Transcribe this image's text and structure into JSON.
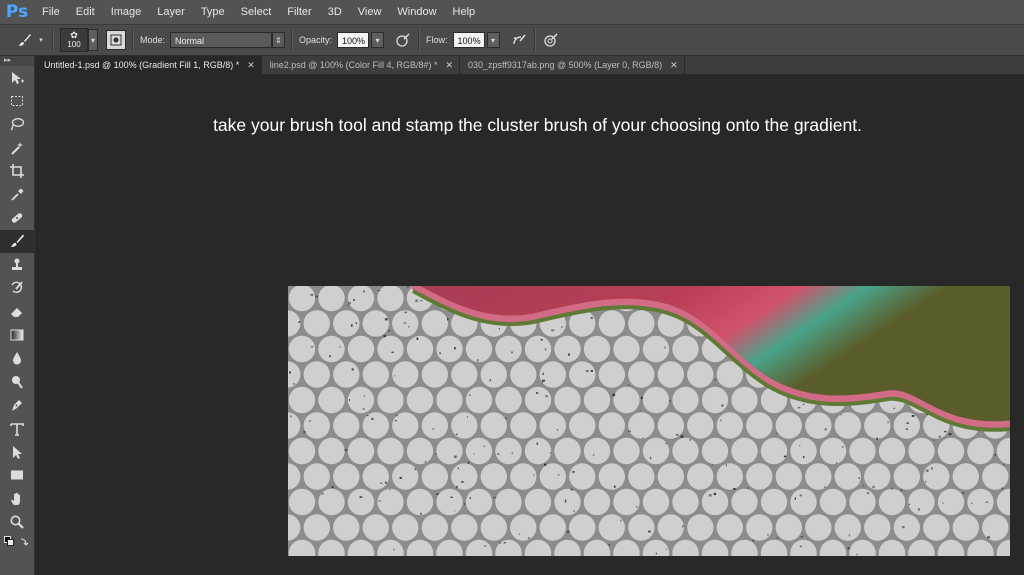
{
  "app": {
    "logo": "Ps"
  },
  "menu": [
    "File",
    "Edit",
    "Image",
    "Layer",
    "Type",
    "Select",
    "Filter",
    "3D",
    "View",
    "Window",
    "Help"
  ],
  "options": {
    "tool_icon": "brush-icon",
    "brush_size": "100",
    "mode_label": "Mode:",
    "mode_value": "Normal",
    "opacity_label": "Opacity:",
    "opacity_value": "100%",
    "flow_label": "Flow:",
    "flow_value": "100%"
  },
  "tabs": [
    {
      "label": "Untitled-1.psd @ 100% (Gradient Fill 1, RGB/8) *",
      "active": true
    },
    {
      "label": "line2.psd @ 100% (Color Fill 4, RGB/8#) *",
      "active": false
    },
    {
      "label": "030_zpsff9317ab.png @ 500% (Layer 0, RGB/8)",
      "active": false
    }
  ],
  "tools": [
    "move-tool-icon",
    "marquee-tool-icon",
    "lasso-tool-icon",
    "magic-wand-icon",
    "crop-tool-icon",
    "eyedropper-icon",
    "healing-brush-icon",
    "brush-tool-icon",
    "clone-stamp-icon",
    "history-brush-icon",
    "eraser-icon",
    "gradient-tool-icon",
    "blur-tool-icon",
    "dodge-tool-icon",
    "pen-tool-icon",
    "type-tool-icon",
    "path-selection-icon",
    "shape-tool-icon",
    "hand-tool-icon",
    "zoom-tool-icon"
  ],
  "instruction": "take your brush tool and stamp the cluster brush of your choosing onto the gradient.",
  "colors": {
    "gradient_red": "#c44a5e",
    "gradient_teal": "#4aa38a",
    "gradient_olive": "#5a5d2a",
    "stripe_pink": "#d26b86",
    "stripe_green": "#5e7a34",
    "circle_fill": "#cfcfcf",
    "pattern_bg": "#8c8c8c"
  }
}
